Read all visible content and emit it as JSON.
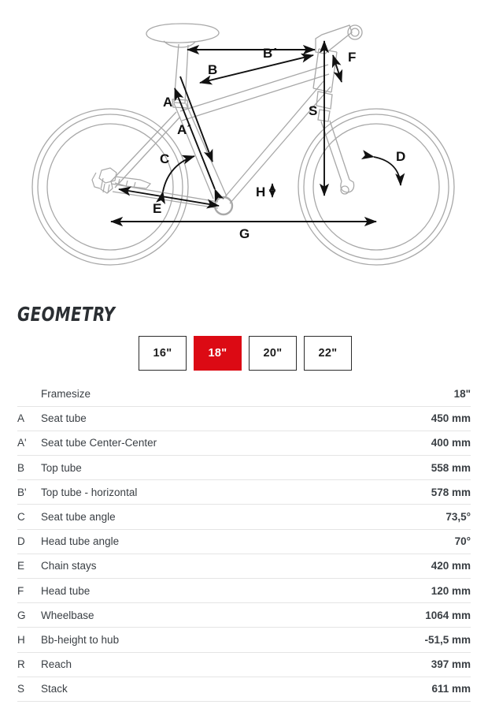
{
  "section": {
    "heading": "GEOMETRY"
  },
  "size_selector": {
    "options": [
      {
        "label": "16\"",
        "selected": false
      },
      {
        "label": "18\"",
        "selected": true
      },
      {
        "label": "20\"",
        "selected": false
      },
      {
        "label": "22\"",
        "selected": false
      }
    ],
    "selected_value": "18\"",
    "selected_color": "#dc0a14"
  },
  "table": {
    "rows": [
      {
        "letter": "",
        "label": "Framesize",
        "value": "18\""
      },
      {
        "letter": "A",
        "label": "Seat tube",
        "value": "450 mm"
      },
      {
        "letter": "A'",
        "label": "Seat tube Center-Center",
        "value": "400 mm"
      },
      {
        "letter": "B",
        "label": "Top tube",
        "value": "558 mm"
      },
      {
        "letter": "B'",
        "label": "Top tube - horizontal",
        "value": "578 mm"
      },
      {
        "letter": "C",
        "label": "Seat tube angle",
        "value": "73,5°"
      },
      {
        "letter": "D",
        "label": "Head tube angle",
        "value": "70°"
      },
      {
        "letter": "E",
        "label": "Chain stays",
        "value": "420 mm"
      },
      {
        "letter": "F",
        "label": "Head tube",
        "value": "120 mm"
      },
      {
        "letter": "G",
        "label": "Wheelbase",
        "value": "1064 mm"
      },
      {
        "letter": "H",
        "label": "Bb-height to hub",
        "value": "-51,5 mm"
      },
      {
        "letter": "R",
        "label": "Reach",
        "value": "397 mm"
      },
      {
        "letter": "S",
        "label": "Stack",
        "value": "611 mm"
      }
    ]
  },
  "diagram": {
    "labels": {
      "A": "A",
      "Aprime": "A´",
      "B": "B",
      "Bprime": "B´",
      "C": "C",
      "D": "D",
      "E": "E",
      "F": "F",
      "G": "G",
      "H": "H",
      "S": "S"
    },
    "line_color": "#a8a8a8",
    "arrow_color": "#111111"
  }
}
